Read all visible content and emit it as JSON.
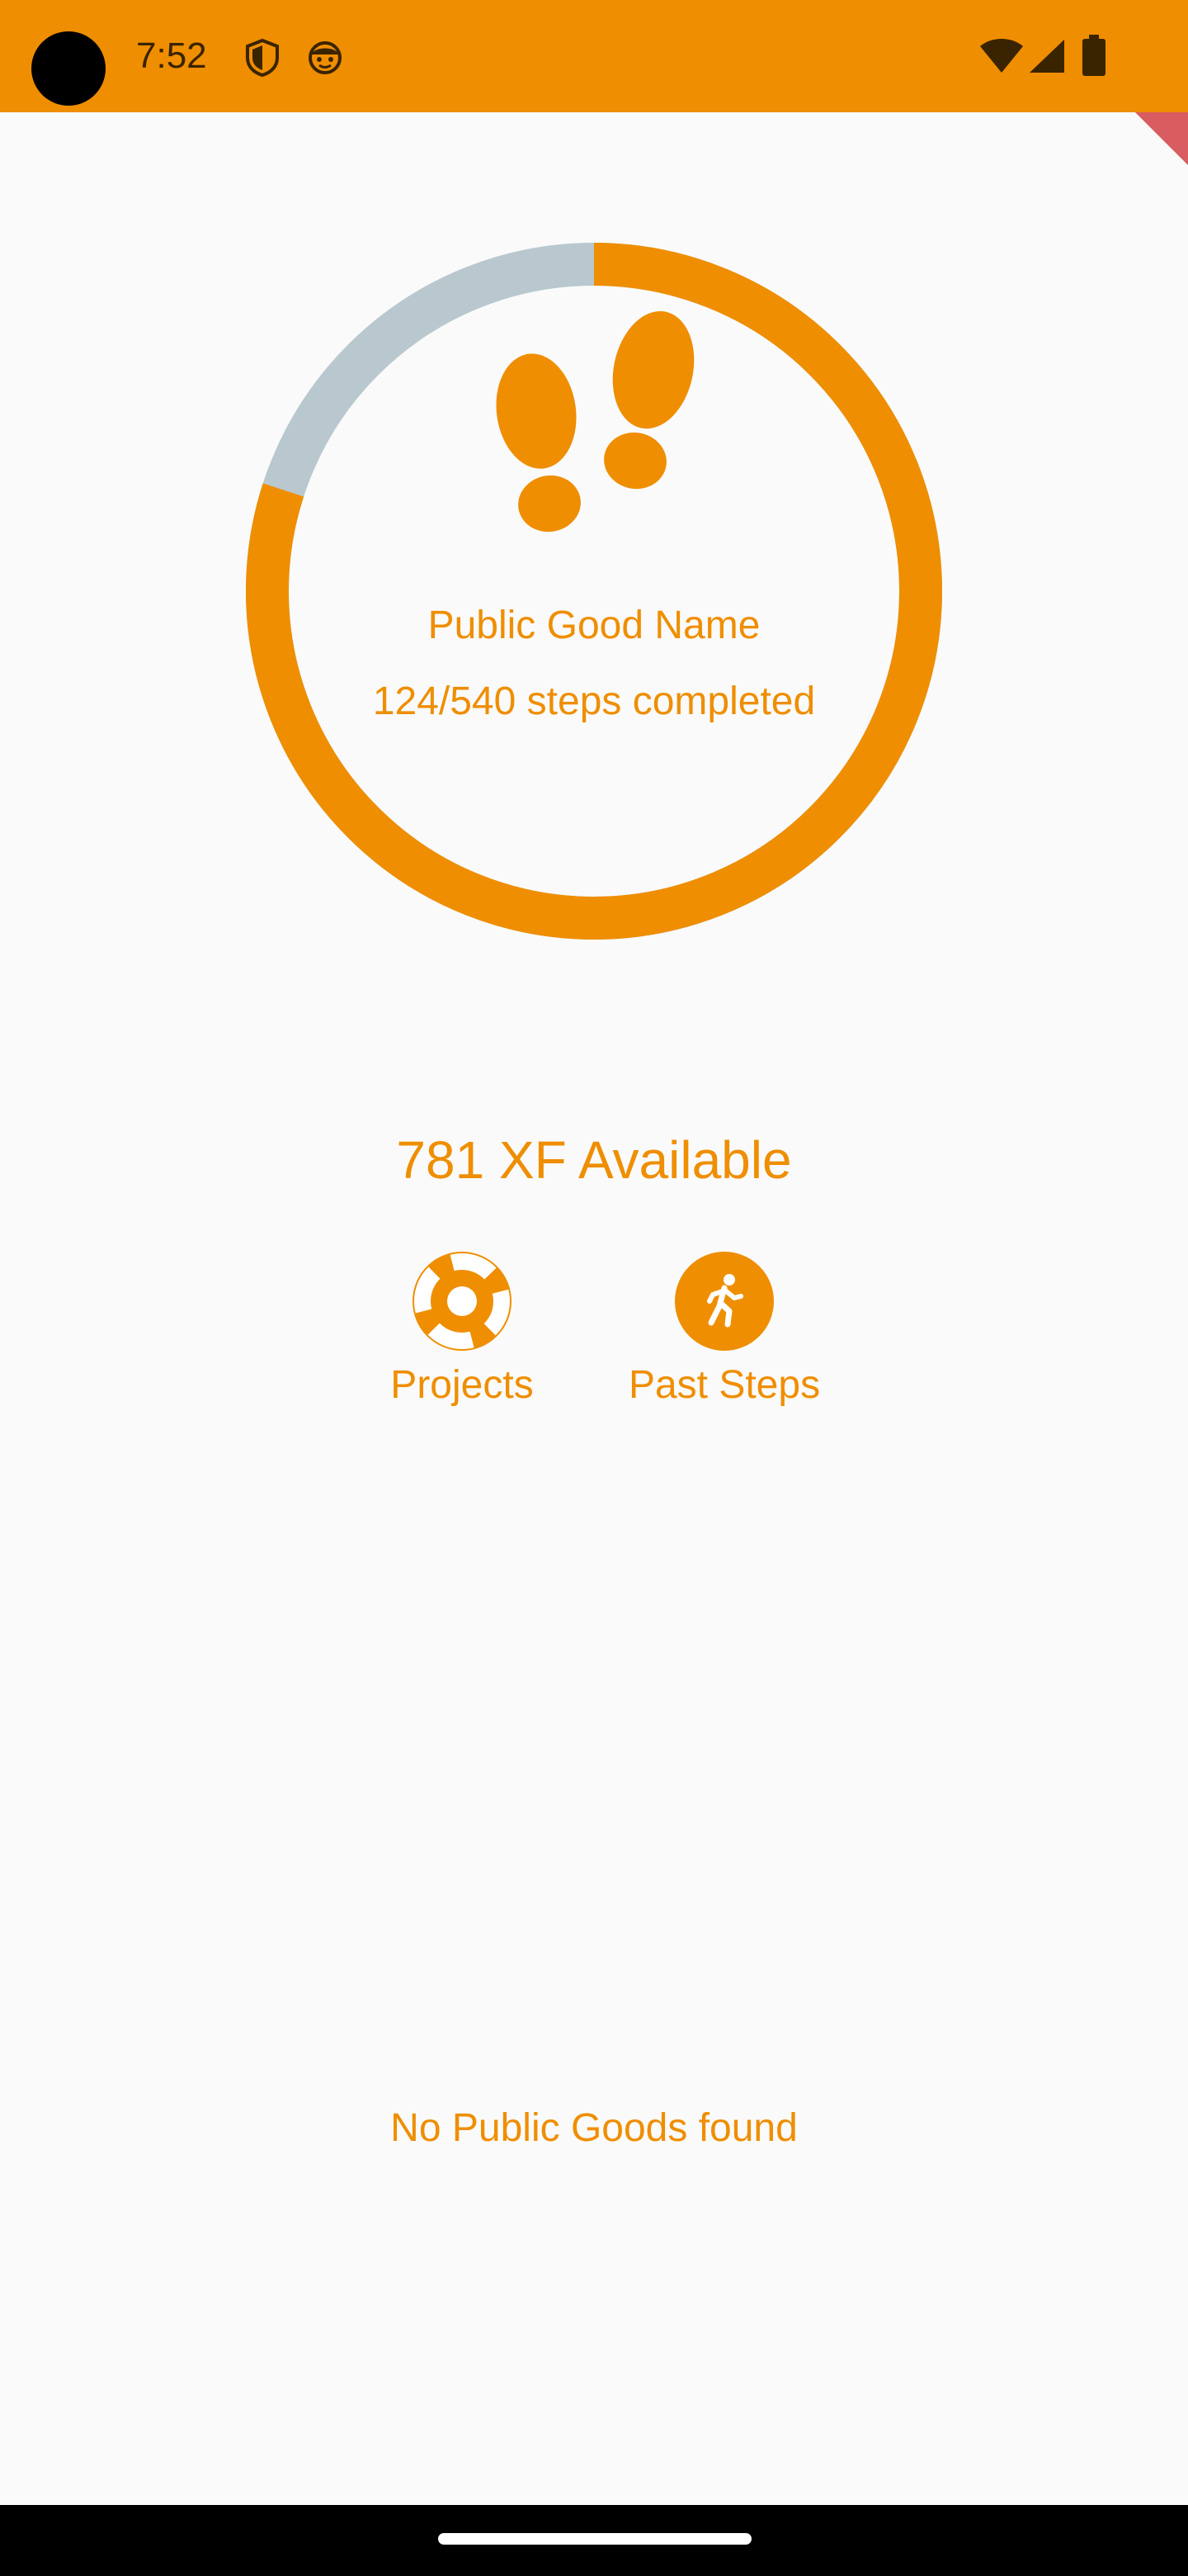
{
  "status_bar": {
    "time": "7:52",
    "background_color": "#EF8E00",
    "icons": [
      "shield-icon",
      "face-icon",
      "wifi-icon",
      "cellular-signal-icon",
      "battery-icon"
    ]
  },
  "progress": {
    "title": "Public Good Name",
    "steps_text": "124/540 steps completed",
    "fraction": 0.8,
    "ring_color": "#EF8E00",
    "track_color": "#B8C8CE",
    "icon": "footprints-icon"
  },
  "balance": {
    "text": "781 XF Available"
  },
  "actions": [
    {
      "label": "Projects",
      "icon": "lifebuoy-icon"
    },
    {
      "label": "Past Steps",
      "icon": "running-person-icon"
    }
  ],
  "empty_state": {
    "text": "No Public Goods found"
  },
  "colors": {
    "accent": "#EF8E00",
    "background": "#FAFAFA",
    "debug_banner": "#D85C60"
  }
}
